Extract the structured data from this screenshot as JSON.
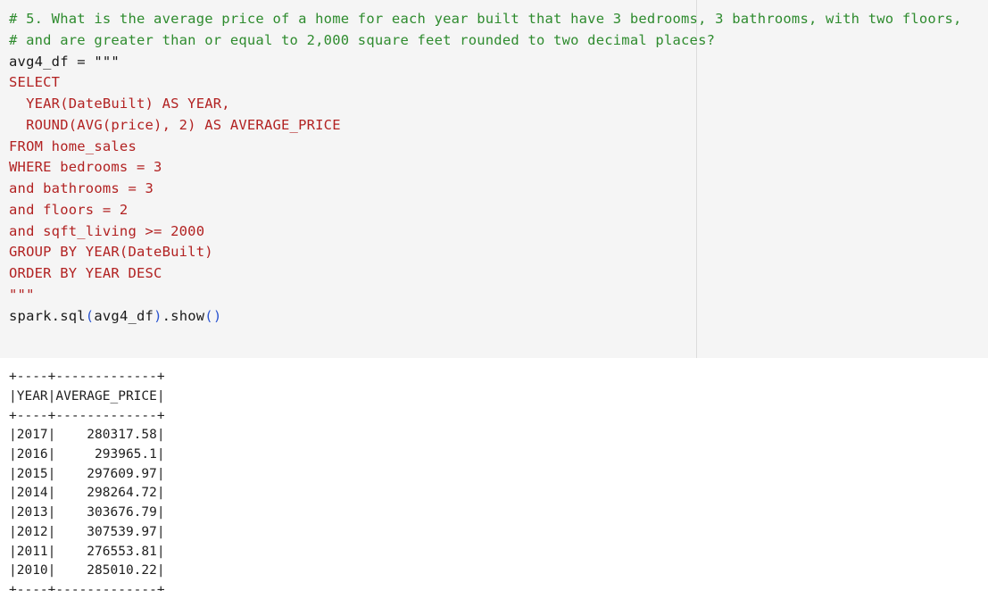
{
  "code_cell": {
    "lines": [
      "# 5. What is the average price of a home for each year built that have 3 bedrooms, 3 bathrooms, with two floors,",
      "# and are greater than or equal to 2,000 square feet rounded to two decimal places?",
      "avg4_df = \"\"\"",
      "SELECT",
      "  YEAR(DateBuilt) AS YEAR,",
      "  ROUND(AVG(price), 2) AS AVERAGE_PRICE",
      "FROM home_sales",
      "WHERE bedrooms = 3",
      "and bathrooms = 3",
      "and floors = 2",
      "and sqft_living >= 2000",
      "GROUP BY YEAR(DateBuilt)",
      "ORDER BY YEAR DESC",
      "\"\"\"",
      "",
      "spark.sql(avg4_df).show()"
    ],
    "last_line_parts": {
      "prefix": "spark.sql",
      "open1": "(",
      "arg": "avg4_df",
      "close1": ")",
      "method": ".show",
      "open2": "(",
      "close2": ")"
    }
  },
  "output": {
    "lines": [
      "+----+-------------+",
      "|YEAR|AVERAGE_PRICE|",
      "+----+-------------+",
      "|2017|    280317.58|",
      "|2016|     293965.1|",
      "|2015|    297609.97|",
      "|2014|    298264.72|",
      "|2013|    303676.79|",
      "|2012|    307539.97|",
      "|2011|    276553.81|",
      "|2010|    285010.22|",
      "+----+-------------+"
    ]
  },
  "colors": {
    "comment": "#2e8b2e",
    "sql_text": "#b22222",
    "code_text": "#1a1a1a",
    "parens": "#2b55d0",
    "cell_background": "#f5f5f5"
  }
}
